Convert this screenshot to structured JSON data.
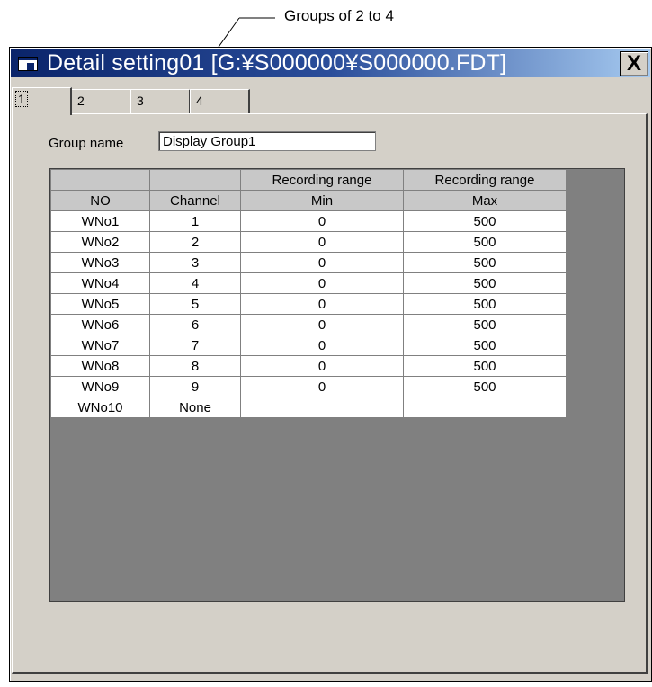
{
  "annotation": {
    "text": "Groups of 2 to 4"
  },
  "window": {
    "title": "Detail setting01 [G:¥S000000¥S000000.FDT]",
    "close_glyph": "X",
    "icon": "window-icon"
  },
  "tabs": [
    {
      "label": "1",
      "active": true
    },
    {
      "label": "2",
      "active": false
    },
    {
      "label": "3",
      "active": false
    },
    {
      "label": "4",
      "active": false
    }
  ],
  "group_name": {
    "label": "Group name",
    "value": "Display Group1"
  },
  "table": {
    "header_row1": [
      "",
      "",
      "Recording range",
      "Recording range"
    ],
    "header_row2": [
      "NO",
      "Channel",
      "Min",
      "Max"
    ],
    "rows": [
      [
        "WNo1",
        "1",
        "0",
        "500"
      ],
      [
        "WNo2",
        "2",
        "0",
        "500"
      ],
      [
        "WNo3",
        "3",
        "0",
        "500"
      ],
      [
        "WNo4",
        "4",
        "0",
        "500"
      ],
      [
        "WNo5",
        "5",
        "0",
        "500"
      ],
      [
        "WNo6",
        "6",
        "0",
        "500"
      ],
      [
        "WNo7",
        "7",
        "0",
        "500"
      ],
      [
        "WNo8",
        "8",
        "0",
        "500"
      ],
      [
        "WNo9",
        "9",
        "0",
        "500"
      ],
      [
        "WNo10",
        "None",
        "",
        ""
      ]
    ]
  }
}
